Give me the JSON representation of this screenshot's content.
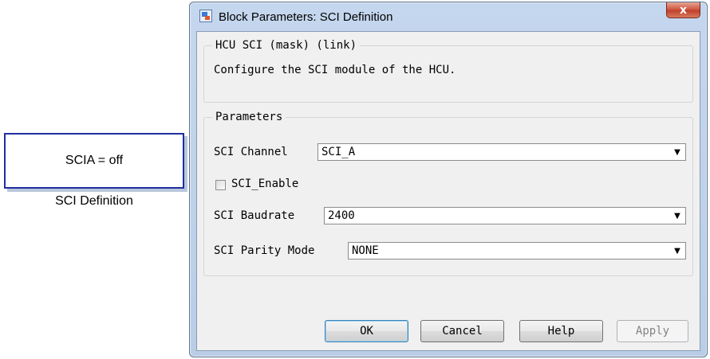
{
  "canvas": {
    "block_text": "SCIA = off",
    "block_name": "SCI Definition"
  },
  "dialog": {
    "title": "Block Parameters: SCI Definition",
    "close_glyph": "x",
    "mask_group": {
      "legend": "HCU SCI (mask) (link)",
      "description": "Configure the SCI module of the HCU."
    },
    "parameters": {
      "legend": "Parameters",
      "sci_channel": {
        "label": "SCI Channel",
        "value": "SCI_A"
      },
      "sci_enable": {
        "label": "SCI_Enable",
        "checked": false
      },
      "sci_baudrate": {
        "label": "SCI Baudrate",
        "value": "2400"
      },
      "sci_parity": {
        "label": "SCI Parity Mode",
        "value": "NONE"
      }
    },
    "buttons": {
      "ok": "OK",
      "cancel": "Cancel",
      "help": "Help",
      "apply": "Apply"
    }
  },
  "icons": {
    "title_icon": "simulink-block-icon",
    "dropdown_arrow": "▼"
  }
}
